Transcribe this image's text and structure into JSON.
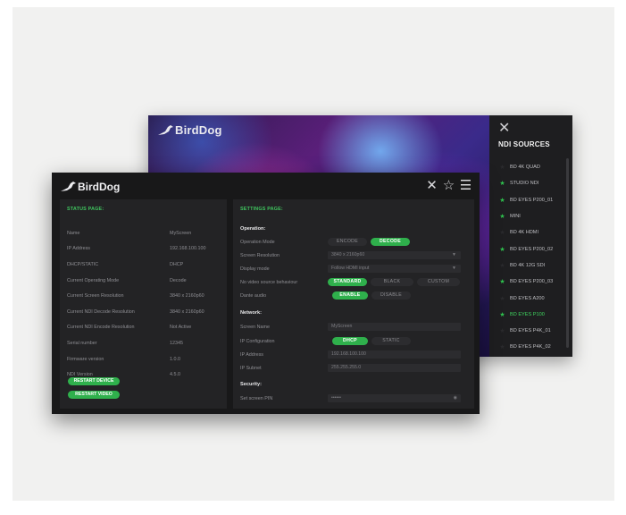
{
  "back_window": {
    "logo_text": "BirdDog",
    "sources": {
      "title": "NDI SOURCES",
      "close_icon": "close-icon",
      "items": [
        {
          "label": "BD 4K QUAD",
          "favorite": false,
          "active": false
        },
        {
          "label": "STUDIO NDI",
          "favorite": true,
          "active": false
        },
        {
          "label": "BD EYES P200_01",
          "favorite": true,
          "active": false
        },
        {
          "label": "MINI",
          "favorite": true,
          "active": false
        },
        {
          "label": "BD 4K HDMI",
          "favorite": false,
          "active": false
        },
        {
          "label": "BD EYES P200_02",
          "favorite": true,
          "active": false
        },
        {
          "label": "BD 4K 12G SDI",
          "favorite": false,
          "active": false
        },
        {
          "label": "BD EYES P200_03",
          "favorite": true,
          "active": false
        },
        {
          "label": "BD EYES A200",
          "favorite": false,
          "active": false
        },
        {
          "label": "BD EYES P100",
          "favorite": true,
          "active": true
        },
        {
          "label": "BD EYES P4K_01",
          "favorite": false,
          "active": false
        },
        {
          "label": "BD EYES P4K_02",
          "favorite": false,
          "active": false
        }
      ]
    }
  },
  "front_window": {
    "logo_text": "BirdDog",
    "header_icons": [
      "close-icon",
      "star-icon",
      "menu-icon"
    ],
    "status": {
      "title": "STATUS PAGE:",
      "rows": [
        {
          "key": "Name",
          "value": "MyScreen"
        },
        {
          "key": "IP Address",
          "value": "192.168.100.100"
        },
        {
          "key": "DHCP/STATIC",
          "value": "DHCP"
        },
        {
          "key": "Current Operating Mode",
          "value": "Decode"
        },
        {
          "key": "Current Screen Resolution",
          "value": "3840 x 2160p60"
        },
        {
          "key": "Current NDI Decode Resolution",
          "value": "3840 x 2160p60"
        },
        {
          "key": "Current NDI Encode Resolution",
          "value": "Not Active"
        },
        {
          "key": "Serial number",
          "value": "12345"
        },
        {
          "key": "Firmware version",
          "value": "1.0.0"
        },
        {
          "key": "NDI Version",
          "value": "4.5.0"
        }
      ],
      "restart_device": "RESTART DEVICE",
      "restart_video": "RESTART VIDEO"
    },
    "settings": {
      "title": "SETTINGS PAGE:",
      "operation_title": "Operation:",
      "operation_mode_label": "Operation Mode",
      "operation_mode_options": [
        "ENCODE",
        "DECODE"
      ],
      "operation_mode_selected": "DECODE",
      "screen_resolution_label": "Screen Resolution",
      "screen_resolution_value": "3840 x 2160p60",
      "display_mode_label": "Display mode",
      "display_mode_value": "Follow HDMI input",
      "no_video_label": "No video source behaviour",
      "no_video_options": [
        "STANDARD",
        "BLACK",
        "CUSTOM"
      ],
      "no_video_selected": "STANDARD",
      "dante_label": "Dante audio",
      "dante_options": [
        "ENABLE",
        "DISABLE"
      ],
      "dante_selected": "ENABLE",
      "network_title": "Network:",
      "screen_name_label": "Screen Name",
      "screen_name_value": "MyScreen",
      "ip_config_label": "IP Configuration",
      "ip_config_options": [
        "DHCP",
        "STATIC"
      ],
      "ip_config_selected": "DHCP",
      "ip_address_label": "IP Address",
      "ip_address_value": "192.168.100.100",
      "ip_subnet_label": "IP Subnet",
      "ip_subnet_value": "255.255.255.0",
      "security_title": "Security:",
      "pin_label": "Set screen PIN",
      "pin_value": "••••••"
    }
  },
  "colors": {
    "accent_green": "#2fb04c",
    "active_text_green": "#3fd35e",
    "window_bg": "#181819",
    "panel_bg": "#232325"
  }
}
